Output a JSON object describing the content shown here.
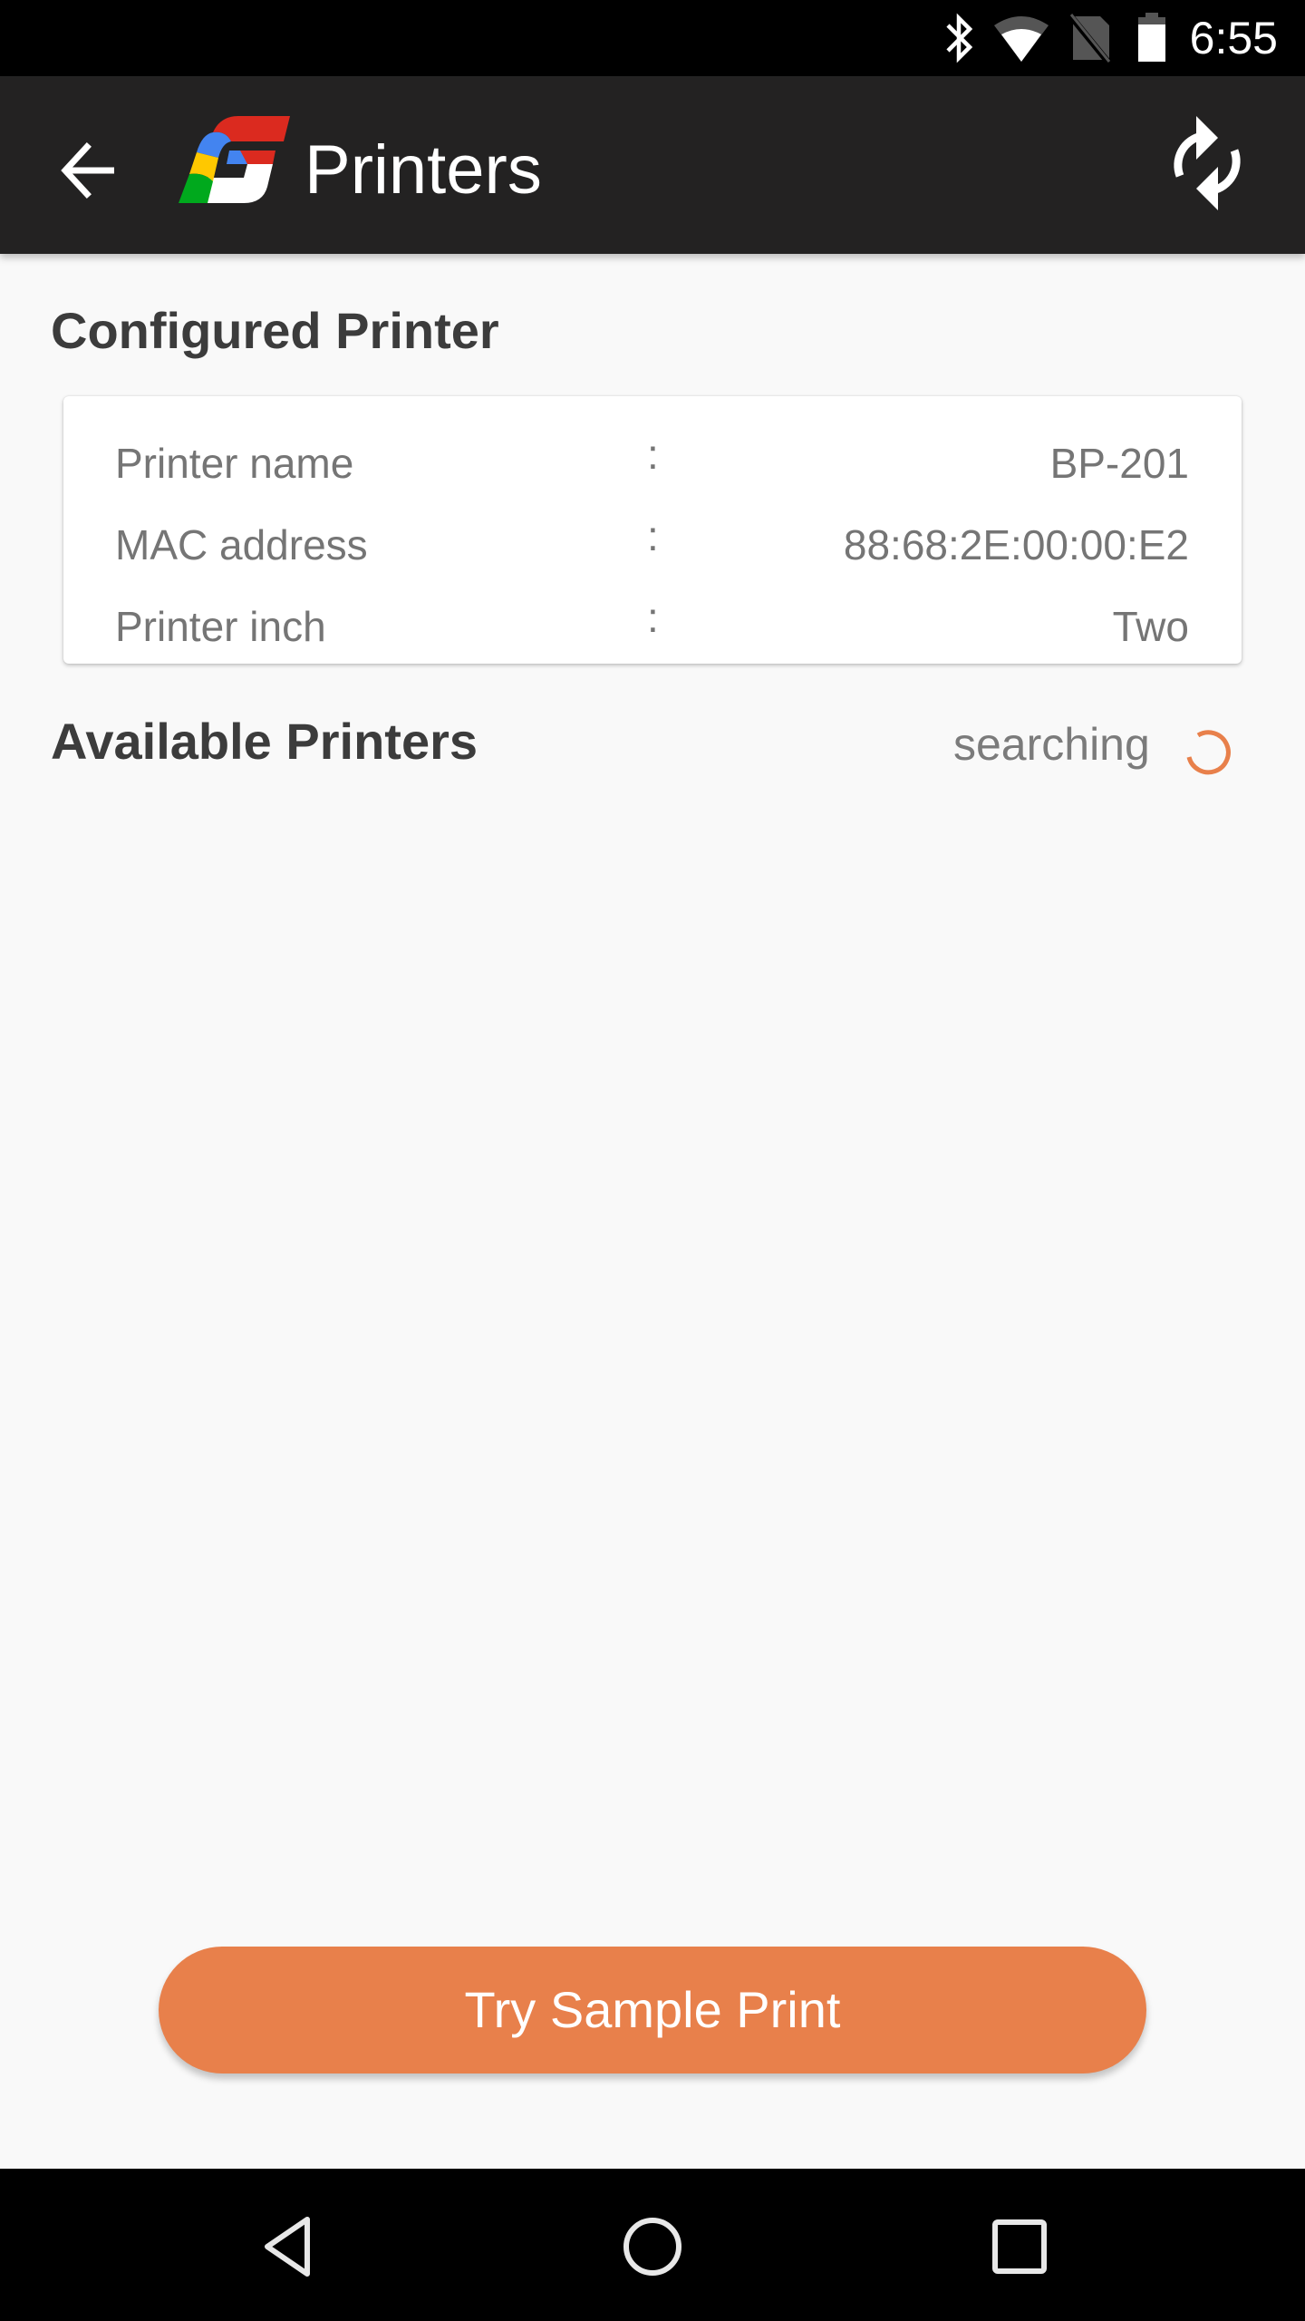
{
  "status_bar": {
    "time": "6:55",
    "icons": [
      "bluetooth-icon",
      "wifi-icon",
      "no-sim-icon",
      "battery-icon"
    ]
  },
  "toolbar": {
    "back_icon": "arrow-left-icon",
    "logo": "app-logo",
    "title": "Printers",
    "refresh_icon": "refresh-icon"
  },
  "configured": {
    "heading": "Configured Printer",
    "separator": ":",
    "rows": [
      {
        "label": "Printer name",
        "value": "BP-201"
      },
      {
        "label": "MAC address",
        "value": "88:68:2E:00:00:E2"
      },
      {
        "label": "Printer inch",
        "value": "Two"
      }
    ]
  },
  "available": {
    "heading": "Available Printers",
    "status_text": "searching",
    "spinner_icon": "loading-spinner-icon"
  },
  "actions": {
    "sample_print_label": "Try Sample Print"
  },
  "nav_bar": {
    "icons": [
      "nav-back-icon",
      "nav-home-icon",
      "nav-recents-icon"
    ]
  },
  "colors": {
    "accent": "#E8804B",
    "toolbar": "#232222",
    "background": "#F9F9F9",
    "text_heading": "#3C3C3C",
    "text_secondary": "#757575",
    "logo_red": "#DB2A1F",
    "logo_blue": "#4384F0",
    "logo_yellow": "#FFC800",
    "logo_green": "#00A91D"
  }
}
